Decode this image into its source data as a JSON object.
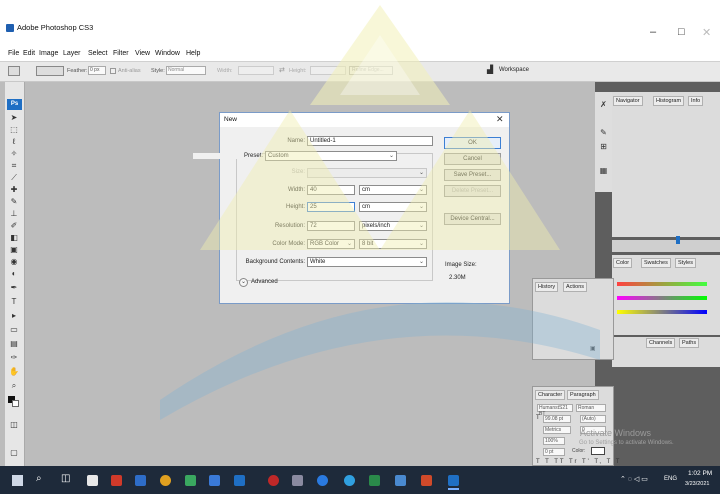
{
  "app": {
    "title": "Adobe Photoshop CS3"
  },
  "window_controls": {
    "minimize": "–",
    "maximize": "□",
    "close": "✕"
  },
  "menu": [
    "File",
    "Edit",
    "Image",
    "Layer",
    "Select",
    "Filter",
    "View",
    "Window",
    "Help"
  ],
  "options_bar": {
    "feather_label": "Feather:",
    "feather_value": "0 px",
    "antialias_label": "Anti-alias",
    "style_label": "Style:",
    "style_value": "Normal",
    "width_label": "Width:",
    "height_label": "Height:",
    "refine_edge": "Refine Edge...",
    "workspace": "Workspace"
  },
  "toolbox": {
    "logo": "Ps"
  },
  "dialog": {
    "title": "New",
    "name_label": "Name:",
    "name_value": "Untitled-1",
    "preset_label": "Preset:",
    "preset_value": "Custom",
    "size_label": "Size:",
    "width_label": "Width:",
    "width_value": "40",
    "width_unit": "cm",
    "height_label": "Height:",
    "height_value": "25",
    "height_unit": "cm",
    "resolution_label": "Resolution:",
    "resolution_value": "72",
    "resolution_unit": "pixels/inch",
    "color_mode_label": "Color Mode:",
    "color_mode_value": "RGB Color",
    "bit_depth_value": "8 bit",
    "background_label": "Background Contents:",
    "background_value": "White",
    "advanced_label": "Advanced",
    "image_size_label": "Image Size:",
    "image_size_value": "2.30M",
    "buttons": {
      "ok": "OK",
      "cancel": "Cancel",
      "save_preset": "Save Preset...",
      "delete_preset": "Delete Preset...",
      "device_central": "Device Central..."
    }
  },
  "panels": {
    "navigator_tab": "Navigator",
    "histogram_tab": "Histogram",
    "info_tab": "Info",
    "color_tab": "Color",
    "swatches_tab": "Swatches",
    "styles_tab": "Styles",
    "history_tab": "History",
    "actions_tab": "Actions",
    "channels_tab": "Channels",
    "paths_tab": "Paths",
    "character_tab": "Character",
    "paragraph_tab": "Paragraph",
    "char_font": "HumanstS21 BT",
    "char_style": "Roman",
    "char_size": "99.08 pt",
    "char_leading": "(Auto)",
    "char_kerning": "Metrics",
    "char_tracking": "0",
    "char_scale": "100%",
    "char_baseline": "0 pt",
    "char_color_label": "Color:"
  },
  "activate": {
    "line1": "Activate Windows",
    "line2": "Go to Settings to activate Windows."
  },
  "taskbar": {
    "time": "1:02 PM",
    "date": "3/23/2021",
    "lang": "ENG"
  },
  "colors": {
    "accent": "#1f6fc4",
    "workspace": "#bcbcbc",
    "dialog_border": "#7a9bc8",
    "taskbar": "#1e2a3a"
  }
}
